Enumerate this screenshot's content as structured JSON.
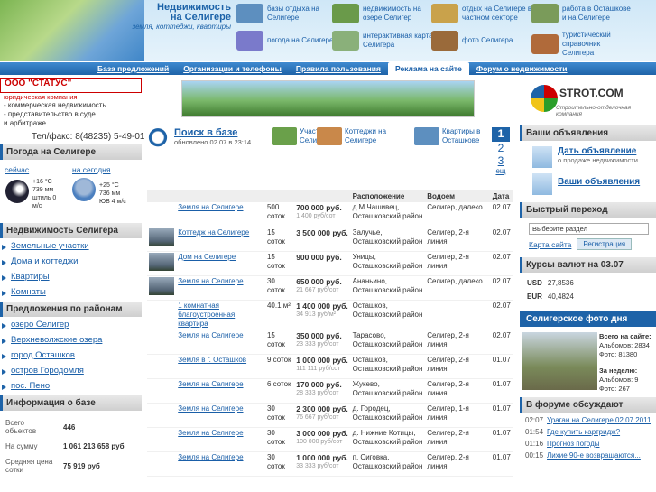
{
  "header": {
    "title": "Недвижимость на Селигере",
    "subtitle": "земля, коттеджи, квартиры",
    "links": [
      {
        "label": "базы отдыха на Селигере",
        "icon": "boats-icon",
        "color": "#5d8fbf"
      },
      {
        "label": "недвижимость на озере Селигер",
        "icon": "forest-icon",
        "color": "#6a9a4a"
      },
      {
        "label": "отдых на Селигере в частном секторе",
        "icon": "house-rent-icon",
        "color": "#c9a24b"
      },
      {
        "label": "работа в Осташкове и на Селигере",
        "icon": "worker-icon",
        "color": "#7a9b5a"
      },
      {
        "label": "погода на Селигере",
        "icon": "weather-icon",
        "color": "#7a7acb"
      },
      {
        "label": "интерактивная карта Селигера",
        "icon": "map-icon",
        "color": "#8ab07a"
      },
      {
        "label": "фото Селигера",
        "icon": "camera-icon",
        "color": "#9a6a3a"
      },
      {
        "label": "туристический справочник Селигера",
        "icon": "tourist-icon",
        "color": "#b06a3a"
      }
    ]
  },
  "nav": {
    "items": [
      "База предложений",
      "Организации и телефоны",
      "Правила пользования",
      "Реклама на сайте",
      "Форум о недвижимости"
    ],
    "active": 3
  },
  "left": {
    "company_name": "ООО \"СТАТУС\"",
    "company_type": "юридическая компания",
    "company_lines": [
      "- коммерческая недвижимость",
      "- представительство в суде",
      "  и арбитраже"
    ],
    "phone": "Тел/факс: 8(48235) 5-49-01",
    "weather": {
      "title": "Погода на Селигере",
      "now_label": "сейчас",
      "today_label": "на сегодня",
      "now": [
        "+16 °C",
        "739 мм",
        "штиль 0",
        "м/с"
      ],
      "today": [
        "+25 °C",
        "736 мм",
        "ЮВ 4 м/с"
      ]
    },
    "realty": {
      "title": "Недвижимость Селигера",
      "items": [
        "Земельные участки",
        "Дома и коттеджи",
        "Квартиры",
        "Комнаты"
      ]
    },
    "regions": {
      "title": "Предложения по районам",
      "items": [
        "озеро Селигер",
        "Верхневолжские озера",
        "город Осташков",
        "остров Городомля",
        "пос. Пено"
      ]
    },
    "info": {
      "title": "Информация о базе",
      "rows": [
        {
          "k": "Всего объектов",
          "v": "446"
        },
        {
          "k": "На сумму",
          "v": "1 061 213 658 руб"
        },
        {
          "k": "Средняя цена сотки",
          "v": "75 919 руб"
        }
      ]
    }
  },
  "content": {
    "search": {
      "label": "Поиск в базе",
      "updated": "обновлено 02.07 в 23:14"
    },
    "quick": [
      {
        "label": "Участки на Селигере"
      },
      {
        "label": "Коттеджи на Селигере"
      },
      {
        "label": "Квартиры в Осташкове"
      }
    ],
    "pager": {
      "current": "1",
      "pages": [
        "2",
        "3"
      ],
      "more": "ещ"
    },
    "columns": [
      "",
      "",
      "",
      "",
      "Расположение",
      "Водоем",
      "Дата"
    ],
    "rows": [
      {
        "title": "Земля на Селигере",
        "size": "500 соток",
        "price": "700 000 руб.",
        "per": "1 400 руб/сот",
        "loc": "д.М.Чашивец, Осташковский район",
        "water": "Селигер, далеко",
        "date": "02.07",
        "thumb": false
      },
      {
        "title": "Коттедж на Селигере",
        "size": "15 соток",
        "price": "3 500 000 руб.",
        "per": "",
        "loc": "Залучье, Осташковский район",
        "water": "Селигер, 2-я линия",
        "date": "02.07",
        "thumb": true
      },
      {
        "title": "Дом на Селигере",
        "size": "15 соток",
        "price": "900 000 руб.",
        "per": "",
        "loc": "Уницы, Осташковский район",
        "water": "Селигер, 2-я линия",
        "date": "02.07",
        "thumb": true
      },
      {
        "title": "Земля на Селигере",
        "size": "30 соток",
        "price": "650 000 руб.",
        "per": "21 667 руб/сот",
        "loc": "Ананьино, Осташковский район",
        "water": "Селигер, далеко",
        "date": "02.07",
        "thumb": true
      },
      {
        "title": "1 комнатная благоустроенная квартира",
        "size": "40.1 м²",
        "price": "1 400 000 руб.",
        "per": "34 913 руб/м²",
        "loc": "Осташков, Осташковский район",
        "water": "",
        "date": "02.07",
        "thumb": false
      },
      {
        "title": "Земля на Селигере",
        "size": "15 соток",
        "price": "350 000 руб.",
        "per": "23 333 руб/сот",
        "loc": "Тарасово, Осташковский район",
        "water": "Селигер, 2-я линия",
        "date": "02.07",
        "thumb": false
      },
      {
        "title": "Земля в г. Осташков",
        "size": "9 соток",
        "price": "1 000 000 руб.",
        "per": "111 111 руб/сот",
        "loc": "Осташков, Осташковский район",
        "water": "Селигер, 2-я линия",
        "date": "01.07",
        "thumb": false
      },
      {
        "title": "Земля на Селигере",
        "size": "6 соток",
        "price": "170 000 руб.",
        "per": "28 333 руб/сот",
        "loc": "Жукево, Осташковский район",
        "water": "Селигер, 2-я линия",
        "date": "01.07",
        "thumb": false
      },
      {
        "title": "Земля на Селигере",
        "size": "30 соток",
        "price": "2 300 000 руб.",
        "per": "76 667 руб/сот",
        "loc": "д. Городец, Осташковский район",
        "water": "Селигер, 1-я линия",
        "date": "01.07",
        "thumb": false
      },
      {
        "title": "Земля на Селигере",
        "size": "30 соток",
        "price": "3 000 000 руб.",
        "per": "100 000 руб/сот",
        "loc": "д. Нижние Котицы, Осташковский район",
        "water": "Селигер, 2-я линия",
        "date": "01.07",
        "thumb": false
      },
      {
        "title": "Земля на Селигере",
        "size": "30 соток",
        "price": "1 000 000 руб.",
        "per": "33 333 руб/сот",
        "loc": "п. Сиговка, Осташковский район",
        "water": "Селигер, 2-я линия",
        "date": "01.07",
        "thumb": false
      }
    ]
  },
  "right": {
    "stroycom": {
      "name": "STROT.COM",
      "tagline": "Строительно-отделочная компания"
    },
    "ads": {
      "title": "Ваши объявления",
      "add_label": "Дать объявление",
      "add_sub": "о продаже недвижимости",
      "list_label": "Ваши объявления"
    },
    "quick": {
      "title": "Быстрый переход",
      "placeholder": "Выберите раздел",
      "map": "Карта сайта",
      "register": "Регистрация"
    },
    "rates": {
      "title": "Курсы валют на 03.07",
      "rows": [
        {
          "k": "USD",
          "v": "27,8536"
        },
        {
          "k": "EUR",
          "v": "40,4824"
        }
      ]
    },
    "photo": {
      "title": "Селигерское фото дня",
      "all_label": "Всего на сайте:",
      "albums": "Альбомов: 2834",
      "photos": "Фото: 81380",
      "week_label": "За неделю:",
      "week_albums": "Альбомов: 9",
      "week_photos": "Фото: 267"
    },
    "forum": {
      "title": "В форуме обсуждают",
      "rows": [
        {
          "t": "02:07",
          "s": "Ураган на Селигере 02.07.2011"
        },
        {
          "t": "01:54",
          "s": "Где купить картридж?"
        },
        {
          "t": "01:16",
          "s": "Прогноз погоды"
        },
        {
          "t": "00:15",
          "s": "Лихие 90-е возвращаются..."
        }
      ]
    }
  }
}
